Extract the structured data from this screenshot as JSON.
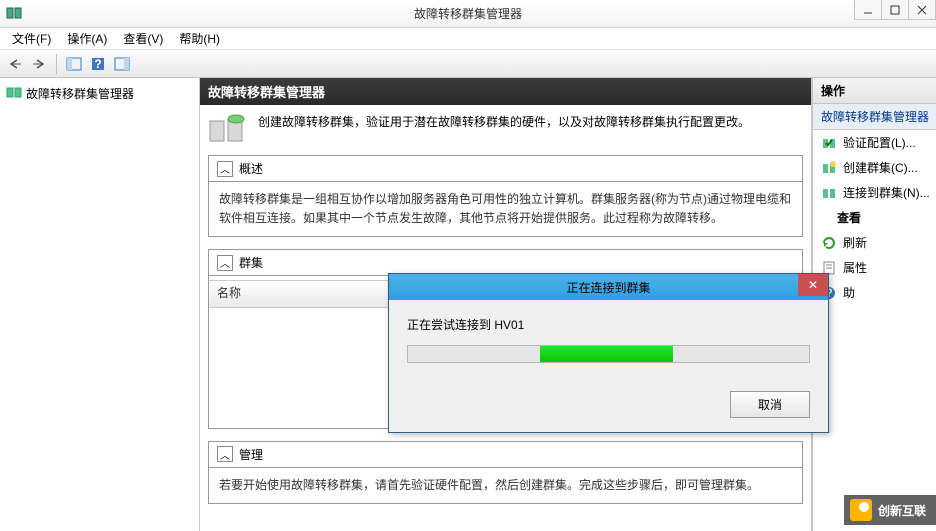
{
  "window": {
    "title": "故障转移群集管理器"
  },
  "menu": {
    "file": "文件(F)",
    "action": "操作(A)",
    "view": "查看(V)",
    "help": "帮助(H)"
  },
  "tree": {
    "root": "故障转移群集管理器"
  },
  "center": {
    "header": "故障转移群集管理器",
    "intro": "创建故障转移群集，验证用于潜在故障转移群集的硬件，以及对故障转移群集执行配置更改。",
    "overview": {
      "title": "概述",
      "text": "故障转移群集是一组相互协作以增加服务器角色可用性的独立计算机。群集服务器(称为节点)通过物理电缆和软件相互连接。如果其中一个节点发生故障，其他节点将开始提供服务。此过程称为故障转移。"
    },
    "clusters": {
      "title": "群集",
      "col_name": "名称"
    },
    "manage": {
      "title": "管理",
      "text": "若要开始使用故障转移群集，请首先验证硬件配置，然后创建群集。完成这些步骤后，即可管理群集。"
    }
  },
  "actions": {
    "header": "操作",
    "subheader": "故障转移群集管理器",
    "items": [
      {
        "label": "验证配置(L)..."
      },
      {
        "label": "创建群集(C)..."
      },
      {
        "label": "连接到群集(N)..."
      }
    ],
    "view": "查看",
    "refresh": "刷新",
    "properties": "属性",
    "help": "助"
  },
  "dialog": {
    "title": "正在连接到群集",
    "message": "正在尝试连接到 HV01",
    "cancel": "取消"
  },
  "watermark": "创新互联"
}
